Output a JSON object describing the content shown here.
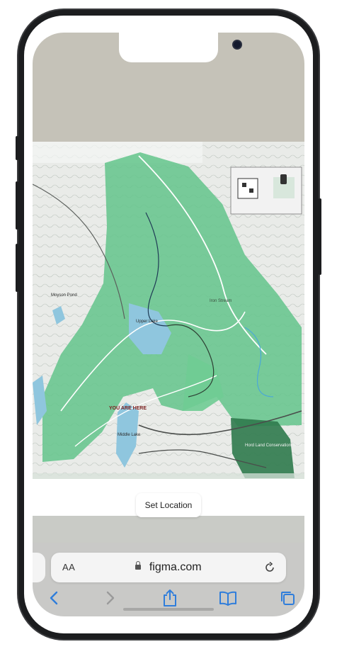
{
  "overlay": {
    "set_location_label": "Set Location"
  },
  "browser": {
    "text_size_label": "AA",
    "url": "figma.com"
  },
  "map": {
    "labels": {
      "upper_lake": "Upper\nLake",
      "middle_lake": "Middle\nLake",
      "you_are_here": "YOU ARE HERE",
      "iron_stream": "Iron Stream",
      "moyson_pond": "Moyson\nPond",
      "land_trust": "Hord Land\nConservation Trust"
    }
  },
  "colors": {
    "accent": "#2f7ddb",
    "map_green": "#63c48b",
    "water": "#8fc6de"
  },
  "icons": {
    "back": "chevron-left-icon",
    "forward": "chevron-right-icon",
    "share": "share-icon",
    "bookmarks": "book-icon",
    "tabs": "tabs-icon",
    "reload": "reload-icon",
    "lock": "lock-icon"
  }
}
